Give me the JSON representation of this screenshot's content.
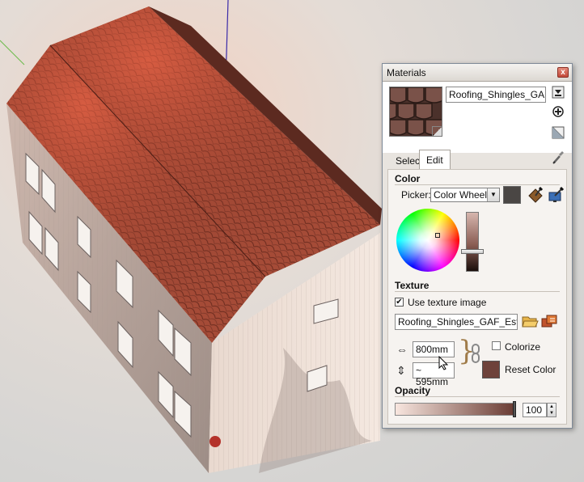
{
  "viewport": {
    "roof_color": "#a34a35",
    "wall_color": "#d8c9bf"
  },
  "panel": {
    "title": "Materials",
    "close_glyph": "x",
    "material_name": "Roofing_Shingles_GAF_E",
    "tabs": [
      {
        "label": "Select",
        "active": false
      },
      {
        "label": "Edit",
        "active": true
      }
    ],
    "icons": {
      "details": "details-arrow-icon",
      "create_material": "create-material-icon",
      "default_material": "default-material-icon",
      "sample_paint": "eyedropper-icon",
      "match_model_color": "match-model-color-icon",
      "match_screen_color": "match-screen-color-icon",
      "browse_texture": "browse-folder-icon",
      "edit_texture": "edit-texture-icon",
      "lock_aspect": "chain-link-icon"
    },
    "color_section": {
      "label": "Color",
      "picker_label": "Picker:",
      "picker_value": "Color Wheel",
      "current_color": "#4a4644"
    },
    "texture_section": {
      "label": "Texture",
      "use_texture_label": "Use texture image",
      "use_texture_checked": true,
      "texture_file": "Roofing_Shingles_GAF_Estates",
      "width_value": "800mm",
      "height_value": "~ 595mm",
      "colorize_label": "Colorize",
      "colorize_checked": false,
      "reset_color_label": "Reset Color",
      "reset_color_swatch": "#6e423b"
    },
    "opacity_section": {
      "label": "Opacity",
      "value": "100",
      "level_percent": 100
    }
  }
}
